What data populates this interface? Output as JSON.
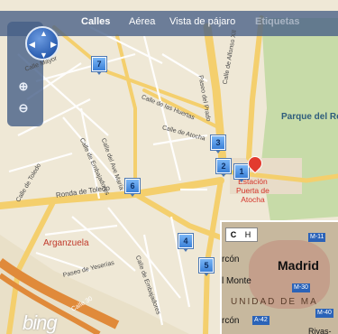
{
  "toolbar": {
    "tabs": [
      {
        "label": "Calles"
      },
      {
        "label": "Aérea"
      },
      {
        "label": "Vista de pájaro"
      },
      {
        "label": "Etiquetas"
      }
    ]
  },
  "nav": {
    "pan_icon": "pan-compass-icon",
    "zoom_in_icon": "zoom-in-icon",
    "zoom_out_icon": "zoom-out-icon"
  },
  "streets": [
    "Calle Mayor",
    "Calle de las Huertas",
    "Paseo del Prado",
    "Calle de Alfonso XII",
    "Calle de Atocha",
    "Calle del Ave María",
    "Calle de Embajadores",
    "Ronda de Toledo",
    "Calle de Toledo",
    "Paseo de Yeserías",
    "Calle de Embajadores",
    "Calle 30"
  ],
  "places": {
    "park": "Parque del Re",
    "district": "Arganzuela",
    "station_line1": "Estación",
    "station_line2": "Puerta de",
    "station_line3": "Atocha"
  },
  "markers": [
    "7",
    "3",
    "2",
    "1",
    "6",
    "4",
    "5"
  ],
  "minimap": {
    "tab_c": "C",
    "tab_h": "H",
    "city": "Madrid",
    "label_monte": "l Monte",
    "label_alcorcon_top": "rcón",
    "label_alcorcon_bottom": "rcón",
    "label_comunidad": "UNIDAD DE MA",
    "label_rivas": "Rivas-",
    "hwy_m11": "M-11",
    "hwy_m30": "M-30",
    "hwy_a42": "A-42",
    "hwy_m40": "M-40"
  },
  "branding": {
    "logo": "bing"
  }
}
